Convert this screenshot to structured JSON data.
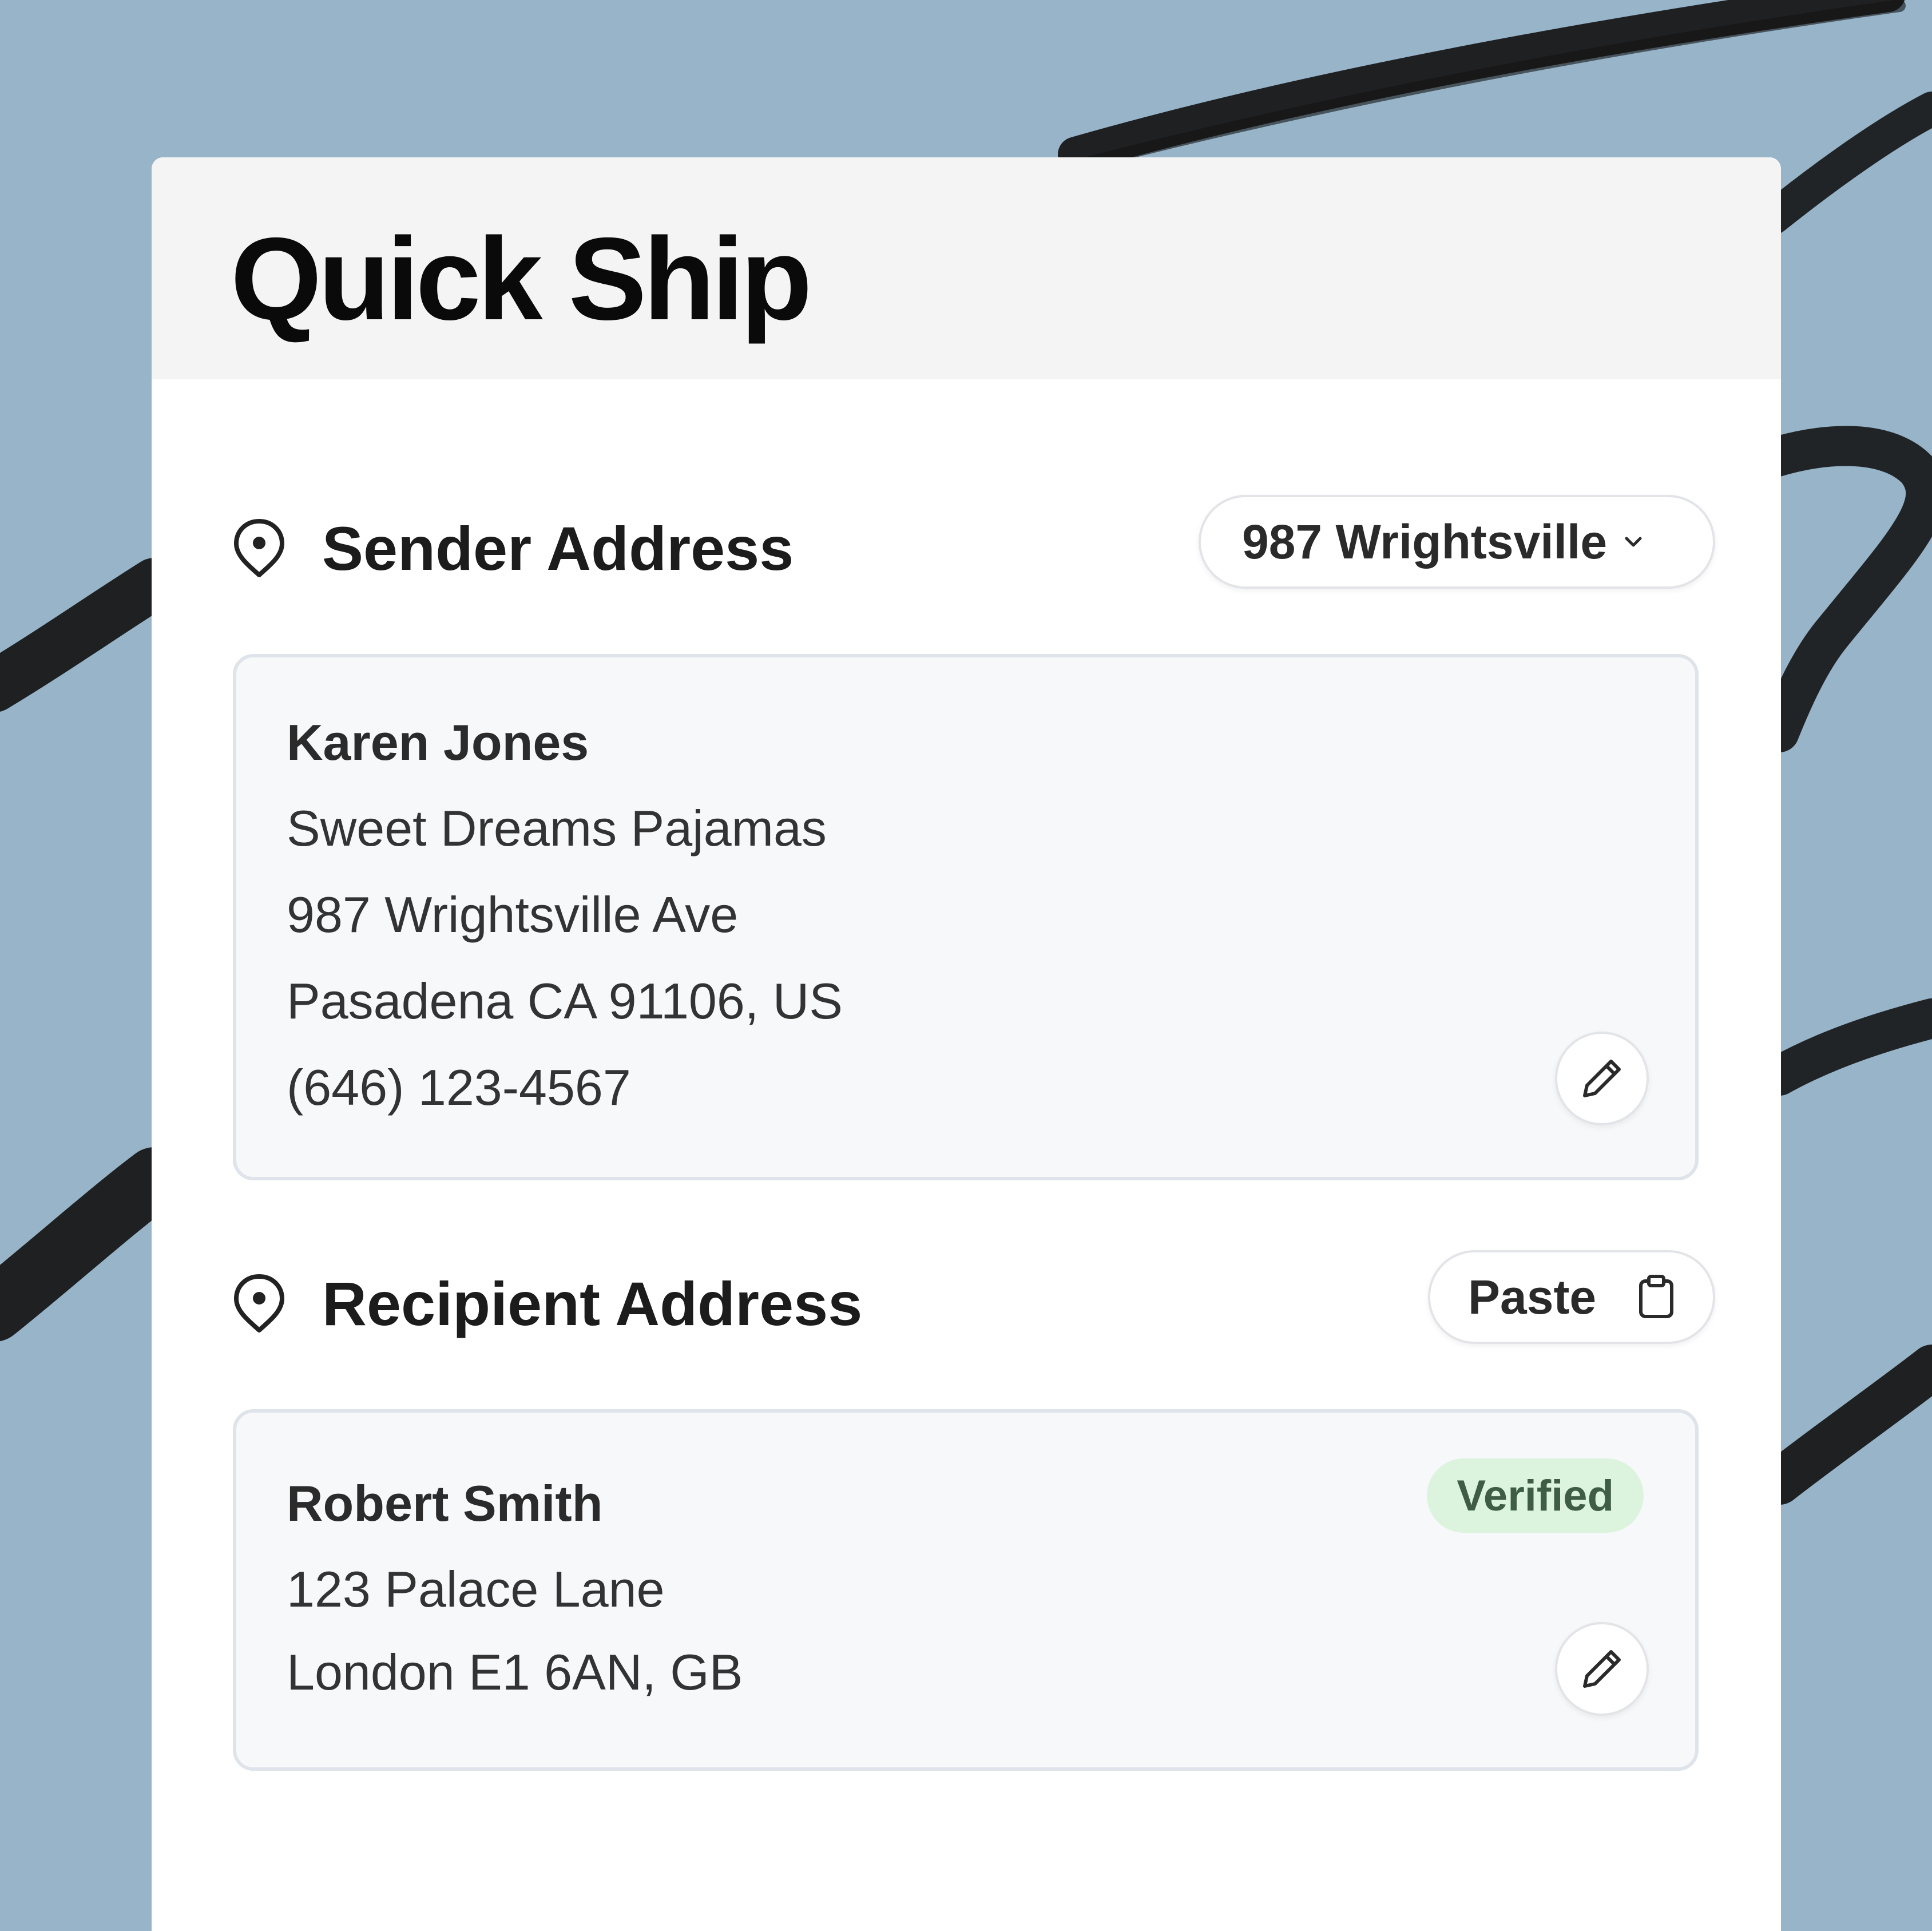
{
  "title": "Quick Ship",
  "sender": {
    "heading": "Sender Address",
    "heading_icon": "map-pin-icon",
    "selector": {
      "value": "987 Wrightsville",
      "icon": "chevron-down-icon"
    },
    "address": {
      "name": "Karen Jones",
      "company": "Sweet Dreams Pajamas",
      "street": "987 Wrightsville Ave",
      "city_line": "Pasadena CA 91106, US",
      "phone": "(646) 123-4567"
    },
    "edit_icon": "pencil-icon"
  },
  "recipient": {
    "heading": "Recipient Address",
    "heading_icon": "map-pin-icon",
    "paste": {
      "label": "Paste",
      "icon": "clipboard-icon"
    },
    "address": {
      "name": "Robert Smith",
      "street": "123 Palace Lane",
      "city_line": "London E1 6AN, GB"
    },
    "status_badge": "Verified",
    "edit_icon": "pencil-icon"
  },
  "colors": {
    "background": "#97b4c9",
    "card": "#ffffff",
    "header": "#f4f4f4",
    "address_box": "#f7f8fa",
    "verified_badge": "#dcf3de",
    "brush_strokes": "#141414"
  }
}
